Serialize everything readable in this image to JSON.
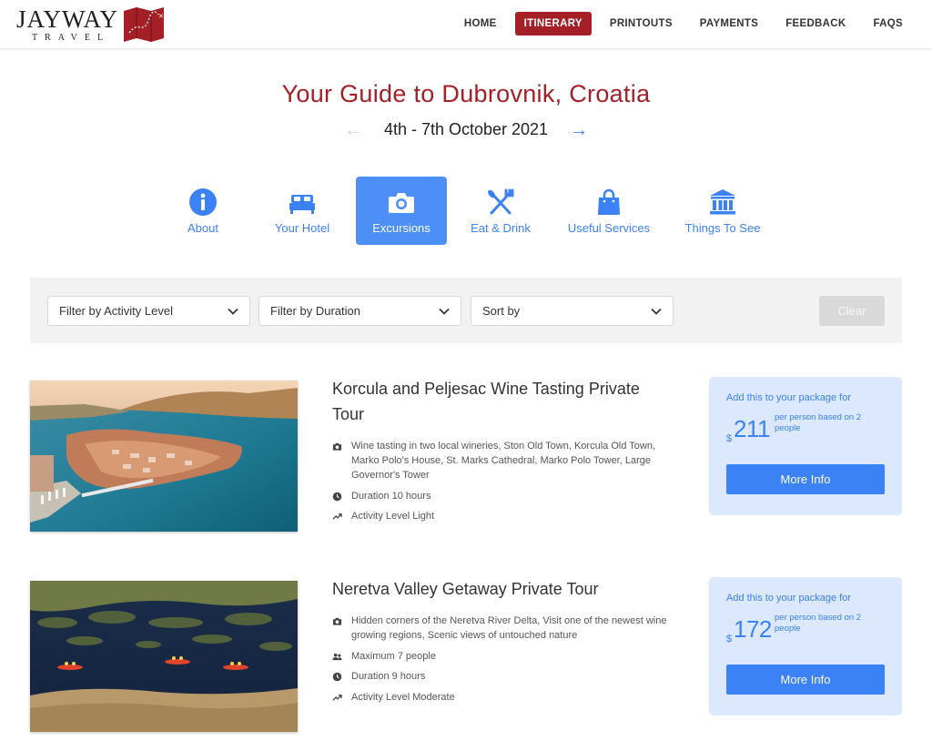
{
  "brand": {
    "name": "JAYWAY",
    "sub": "TRAVEL",
    "accent": "#a51f27"
  },
  "nav": {
    "items": [
      {
        "label": "HOME"
      },
      {
        "label": "ITINERARY"
      },
      {
        "label": "PRINTOUTS"
      },
      {
        "label": "PAYMENTS"
      },
      {
        "label": "FEEDBACK"
      },
      {
        "label": "FAQS"
      }
    ],
    "active": "ITINERARY"
  },
  "hero": {
    "title": "Your Guide to Dubrovnik, Croatia",
    "dates": "4th - 7th October 2021",
    "prev_icon": "arrow-left-icon",
    "next_icon": "arrow-right-icon"
  },
  "tabs": [
    {
      "label": "About",
      "icon": "info-icon"
    },
    {
      "label": "Your Hotel",
      "icon": "bed-icon"
    },
    {
      "label": "Excursions",
      "icon": "camera-icon",
      "active": true
    },
    {
      "label": "Eat & Drink",
      "icon": "utensils-icon"
    },
    {
      "label": "Useful Services",
      "icon": "shopping-bag-icon"
    },
    {
      "label": "Things To See",
      "icon": "landmark-icon"
    }
  ],
  "filters": {
    "activity": "Filter by Activity Level",
    "duration": "Filter by Duration",
    "sort": "Sort by",
    "clear": "Clear"
  },
  "excursions": [
    {
      "title": "Korcula and Peljesac Wine Tasting Private Tour",
      "highlights": "Wine tasting in two local wineries, Ston Old Town, Korcula Old Town, Marko Polo's House, St. Marks Cathedral, Marko Polo Tower, Large Governor's Tower",
      "duration": "Duration 10 hours",
      "activity": "Activity Level Light",
      "price_label": "Add this to your package for",
      "currency": "$",
      "price": "211",
      "price_note": "per person based on 2 people",
      "button": "More Info"
    },
    {
      "title": "Neretva Valley Getaway Private Tour",
      "highlights": "Hidden corners of the Neretva River Delta, Visit one of the newest wine growing regions, Scenic views of untouched nature",
      "group": "Maximum 7 people",
      "duration": "Duration 9 hours",
      "activity": "Activity Level Moderate",
      "price_label": "Add this to your package for",
      "currency": "$",
      "price": "172",
      "price_note": "per person based on 2 people",
      "button": "More Info"
    }
  ]
}
